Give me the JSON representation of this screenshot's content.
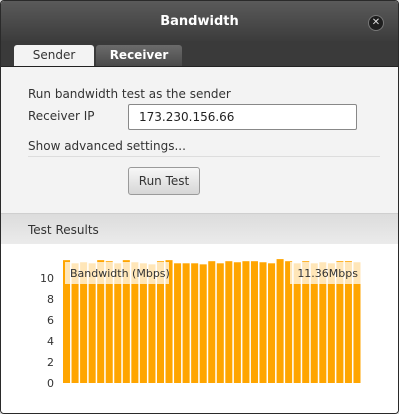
{
  "window": {
    "title": "Bandwidth"
  },
  "tabs": [
    {
      "label": "Sender",
      "active": true
    },
    {
      "label": "Receiver",
      "active": false
    }
  ],
  "sender": {
    "intro": "Run bandwidth test as the sender",
    "receiver_ip_label": "Receiver IP",
    "receiver_ip_value": "173.230.156.66",
    "advanced_link": "Show advanced settings...",
    "run_button": "Run Test"
  },
  "results": {
    "title": "Test Results"
  },
  "chart_data": {
    "type": "bar",
    "title": "Bandwidth (Mbps)",
    "current_value_label": "11.36Mbps",
    "ylim": [
      0,
      12
    ],
    "yticks": [
      0,
      2,
      4,
      6,
      8,
      10
    ],
    "bar_color": "#ffa500",
    "values": [
      11.7,
      11.4,
      11.5,
      11.4,
      11.7,
      11.6,
      11.4,
      11.7,
      11.5,
      11.4,
      11.3,
      11.6,
      11.7,
      11.4,
      11.4,
      11.4,
      11.3,
      11.6,
      11.4,
      11.6,
      11.5,
      11.6,
      11.6,
      11.5,
      11.4,
      11.8,
      11.6,
      11.4,
      11.6,
      11.4,
      11.5,
      11.4,
      11.6,
      11.6,
      11.5
    ]
  }
}
